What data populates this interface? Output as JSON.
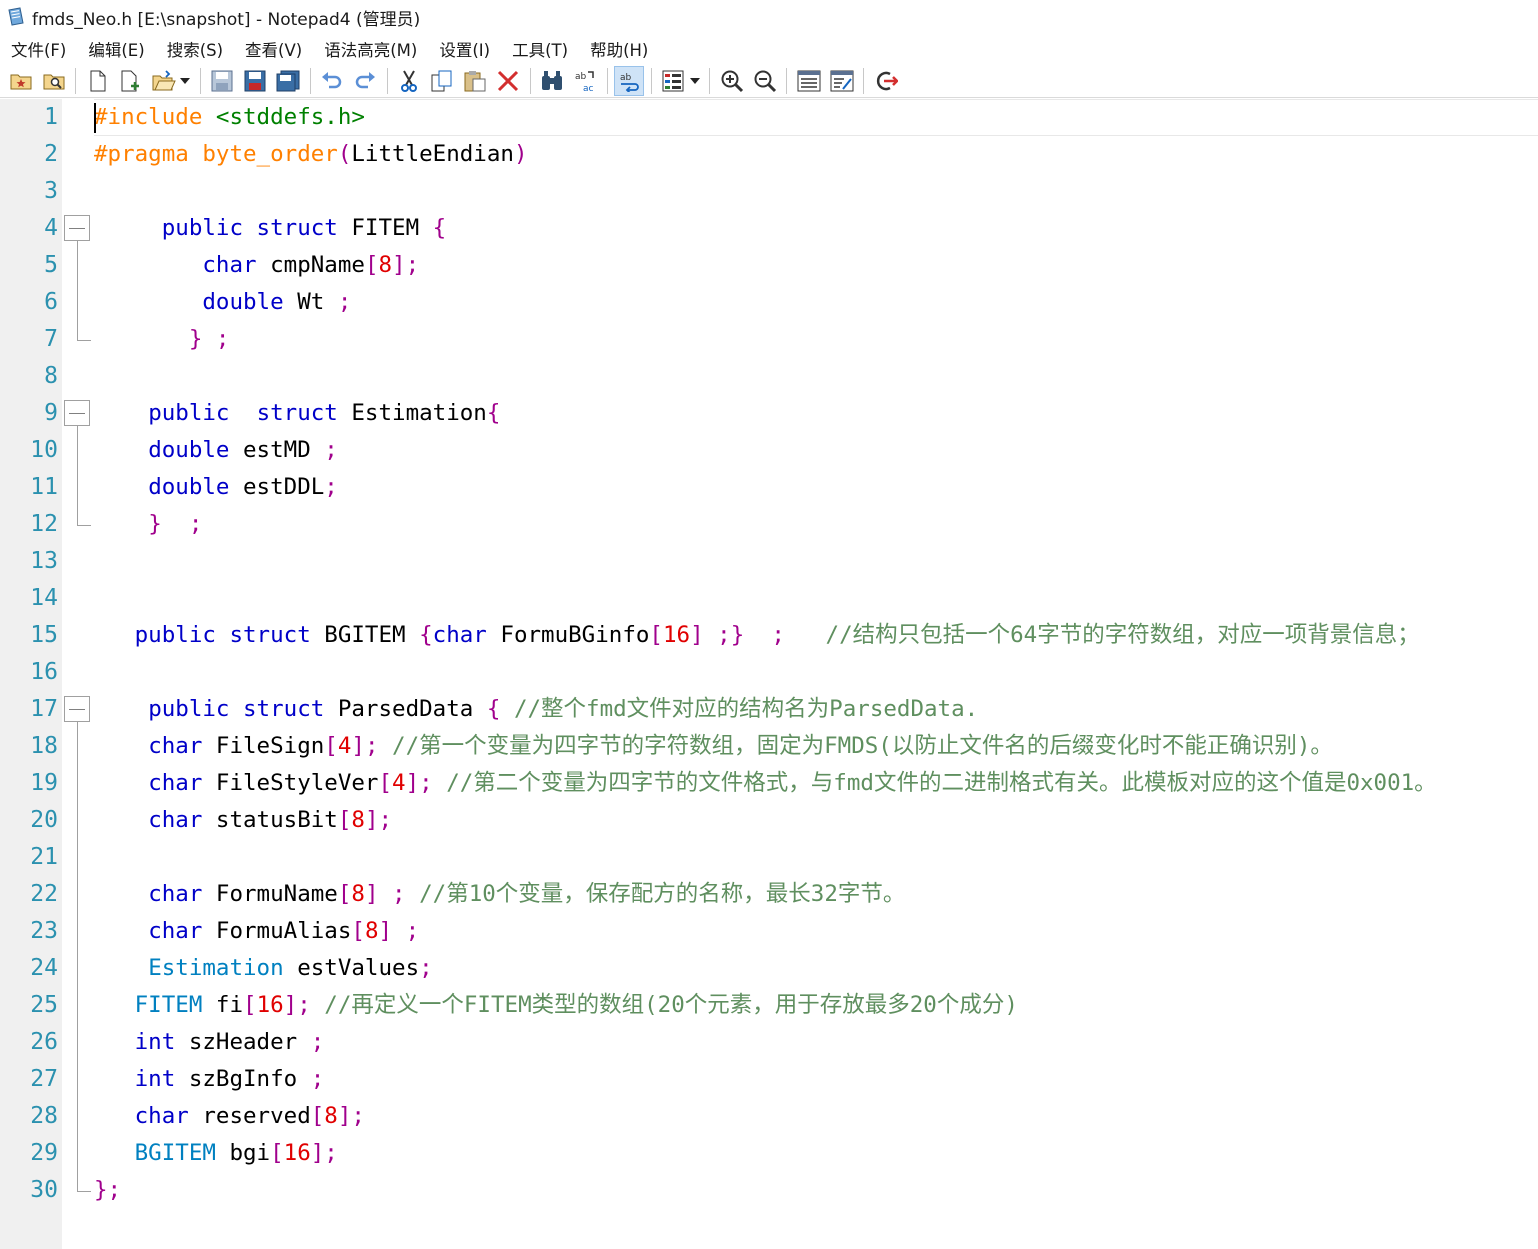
{
  "window": {
    "title": "fmds_Neo.h [E:\\snapshot] - Notepad4 (管理员)"
  },
  "menu": [
    "文件(F)",
    "编辑(E)",
    "搜索(S)",
    "查看(V)",
    "语法高亮(M)",
    "设置(I)",
    "工具(T)",
    "帮助(H)"
  ],
  "toolbar": {
    "icons": [
      "favorites-icon",
      "browse-icon",
      "new-file-icon",
      "new-window-icon",
      "open-file-icon",
      "dropdown-arrow-icon",
      "save-icon",
      "save-as-icon",
      "save-copy-icon",
      "undo-icon",
      "redo-icon",
      "cut-icon",
      "copy-icon",
      "paste-icon",
      "delete-icon",
      "find-icon",
      "replace-icon",
      "word-wrap-icon",
      "scheme-icon",
      "dropdown-arrow-icon",
      "zoom-in-icon",
      "zoom-out-icon",
      "settings-icon",
      "properties-icon",
      "exit-icon"
    ]
  },
  "editor": {
    "line_numbers": [
      "1",
      "2",
      "3",
      "4",
      "5",
      "6",
      "7",
      "8",
      "9",
      "10",
      "11",
      "12",
      "13",
      "14",
      "15",
      "16",
      "17",
      "18",
      "19",
      "20",
      "21",
      "22",
      "23",
      "24",
      "25",
      "26",
      "27",
      "28",
      "29",
      "30"
    ],
    "lines": [
      [
        [
          "pp",
          "#include"
        ],
        [
          "t",
          " "
        ],
        [
          "inc",
          "<stddefs.h>"
        ]
      ],
      [
        [
          "pp",
          "#pragma byte_order"
        ],
        [
          "br",
          "("
        ],
        [
          "t",
          "LittleEndian"
        ],
        [
          "br",
          ")"
        ]
      ],
      [],
      [
        [
          "t",
          "     "
        ],
        [
          "kw",
          "public struct"
        ],
        [
          "t",
          " FITEM "
        ],
        [
          "br",
          "{"
        ]
      ],
      [
        [
          "t",
          "        "
        ],
        [
          "kw",
          "char"
        ],
        [
          "t",
          " cmpName"
        ],
        [
          "br",
          "["
        ],
        [
          "num",
          "8"
        ],
        [
          "br",
          "]"
        ],
        [
          "pu",
          ";"
        ]
      ],
      [
        [
          "t",
          "        "
        ],
        [
          "kw",
          "double"
        ],
        [
          "t",
          " Wt "
        ],
        [
          "pu",
          ";"
        ]
      ],
      [
        [
          "t",
          "       "
        ],
        [
          "br",
          "}"
        ],
        [
          "t",
          " "
        ],
        [
          "pu",
          ";"
        ]
      ],
      [],
      [
        [
          "t",
          "    "
        ],
        [
          "kw",
          "public"
        ],
        [
          "t",
          "  "
        ],
        [
          "kw",
          "struct"
        ],
        [
          "t",
          " Estimation"
        ],
        [
          "br",
          "{"
        ]
      ],
      [
        [
          "t",
          "    "
        ],
        [
          "kw",
          "double"
        ],
        [
          "t",
          " estMD "
        ],
        [
          "pu",
          ";"
        ]
      ],
      [
        [
          "t",
          "    "
        ],
        [
          "kw",
          "double"
        ],
        [
          "t",
          " estDDL"
        ],
        [
          "pu",
          ";"
        ]
      ],
      [
        [
          "t",
          "    "
        ],
        [
          "br",
          "}"
        ],
        [
          "t",
          "  "
        ],
        [
          "pu",
          ";"
        ]
      ],
      [],
      [],
      [
        [
          "t",
          "   "
        ],
        [
          "kw",
          "public struct"
        ],
        [
          "t",
          " BGITEM "
        ],
        [
          "br",
          "{"
        ],
        [
          "kw",
          "char"
        ],
        [
          "t",
          " FormuBGinfo"
        ],
        [
          "br",
          "["
        ],
        [
          "num",
          "16"
        ],
        [
          "br",
          "]"
        ],
        [
          "t",
          " "
        ],
        [
          "pu",
          ";"
        ],
        [
          "br",
          "}"
        ],
        [
          "t",
          "  "
        ],
        [
          "pu",
          ";"
        ],
        [
          "t",
          "   "
        ],
        [
          "cm",
          "//结构只包括一个64字节的字符数组，对应一项背景信息；"
        ]
      ],
      [],
      [
        [
          "t",
          "    "
        ],
        [
          "kw",
          "public struct"
        ],
        [
          "t",
          " ParsedData "
        ],
        [
          "br",
          "{"
        ],
        [
          "t",
          " "
        ],
        [
          "cm",
          "//整个fmd文件对应的结构名为ParsedData."
        ]
      ],
      [
        [
          "t",
          "    "
        ],
        [
          "kw",
          "char"
        ],
        [
          "t",
          " FileSign"
        ],
        [
          "br",
          "["
        ],
        [
          "num",
          "4"
        ],
        [
          "br",
          "]"
        ],
        [
          "pu",
          ";"
        ],
        [
          "t",
          " "
        ],
        [
          "cm",
          "//第一个变量为四字节的字符数组，固定为FMDS(以防止文件名的后缀变化时不能正确识别)。"
        ]
      ],
      [
        [
          "t",
          "    "
        ],
        [
          "kw",
          "char"
        ],
        [
          "t",
          " FileStyleVer"
        ],
        [
          "br",
          "["
        ],
        [
          "num",
          "4"
        ],
        [
          "br",
          "]"
        ],
        [
          "pu",
          ";"
        ],
        [
          "t",
          " "
        ],
        [
          "cm",
          "//第二个变量为四字节的文件格式，与fmd文件的二进制格式有关。此模板对应的这个值是0x001。"
        ]
      ],
      [
        [
          "t",
          "    "
        ],
        [
          "kw",
          "char"
        ],
        [
          "t",
          " statusBit"
        ],
        [
          "br",
          "["
        ],
        [
          "num",
          "8"
        ],
        [
          "br",
          "]"
        ],
        [
          "pu",
          ";"
        ]
      ],
      [],
      [
        [
          "t",
          "    "
        ],
        [
          "kw",
          "char"
        ],
        [
          "t",
          " FormuName"
        ],
        [
          "br",
          "["
        ],
        [
          "num",
          "8"
        ],
        [
          "br",
          "]"
        ],
        [
          "t",
          " "
        ],
        [
          "pu",
          ";"
        ],
        [
          "t",
          " "
        ],
        [
          "cm",
          "//第10个变量，保存配方的名称，最长32字节。"
        ]
      ],
      [
        [
          "t",
          "    "
        ],
        [
          "kw",
          "char"
        ],
        [
          "t",
          " FormuAlias"
        ],
        [
          "br",
          "["
        ],
        [
          "num",
          "8"
        ],
        [
          "br",
          "]"
        ],
        [
          "t",
          " "
        ],
        [
          "pu",
          ";"
        ]
      ],
      [
        [
          "t",
          "    "
        ],
        [
          "tp",
          "Estimation"
        ],
        [
          "t",
          " estValues"
        ],
        [
          "pu",
          ";"
        ]
      ],
      [
        [
          "t",
          "   "
        ],
        [
          "tp",
          "FITEM"
        ],
        [
          "t",
          " fi"
        ],
        [
          "br",
          "["
        ],
        [
          "num",
          "16"
        ],
        [
          "br",
          "]"
        ],
        [
          "pu",
          ";"
        ],
        [
          "t",
          " "
        ],
        [
          "cm",
          "//再定义一个FITEM类型的数组(20个元素，用于存放最多20个成分)"
        ]
      ],
      [
        [
          "t",
          "   "
        ],
        [
          "kw",
          "int"
        ],
        [
          "t",
          " szHeader "
        ],
        [
          "pu",
          ";"
        ]
      ],
      [
        [
          "t",
          "   "
        ],
        [
          "kw",
          "int"
        ],
        [
          "t",
          " szBgInfo "
        ],
        [
          "pu",
          ";"
        ]
      ],
      [
        [
          "t",
          "   "
        ],
        [
          "kw",
          "char"
        ],
        [
          "t",
          " reserved"
        ],
        [
          "br",
          "["
        ],
        [
          "num",
          "8"
        ],
        [
          "br",
          "]"
        ],
        [
          "pu",
          ";"
        ]
      ],
      [
        [
          "t",
          "   "
        ],
        [
          "tp",
          "BGITEM"
        ],
        [
          "t",
          " bgi"
        ],
        [
          "br",
          "["
        ],
        [
          "num",
          "16"
        ],
        [
          "br",
          "]"
        ],
        [
          "pu",
          ";"
        ]
      ],
      [
        [
          "pu",
          "};"
        ]
      ]
    ]
  }
}
